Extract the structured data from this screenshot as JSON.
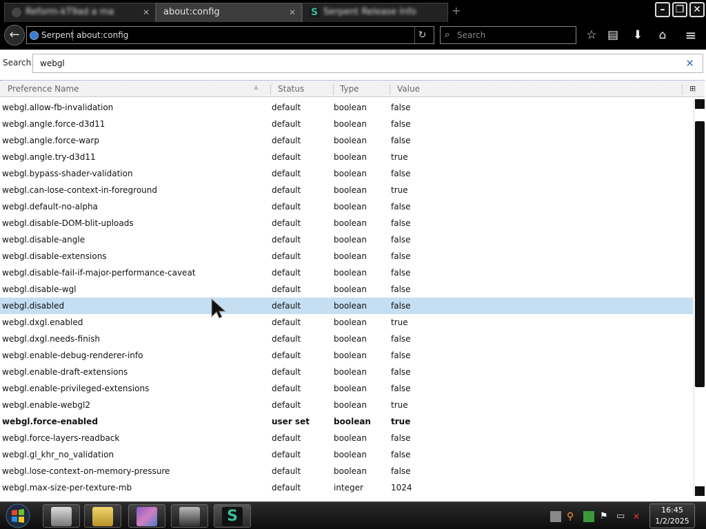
{
  "tabs": [
    {
      "title": "Reform-kT9ad a ma",
      "state": "inactive"
    },
    {
      "title": "about:config",
      "state": "active"
    },
    {
      "title": "Serpent Release Info",
      "state": "inactive"
    }
  ],
  "nav": {
    "identity_label": "Serpent",
    "url": "about:config",
    "search_placeholder": "Search"
  },
  "config": {
    "search_label": "Search:",
    "filter_value": "webgl",
    "columns": {
      "name": "Preference Name",
      "status": "Status",
      "type": "Type",
      "value": "Value"
    },
    "selected_row": 12,
    "rows": [
      {
        "name": "webgl.allow-fb-invalidation",
        "status": "default",
        "type": "boolean",
        "value": "false"
      },
      {
        "name": "webgl.angle.force-d3d11",
        "status": "default",
        "type": "boolean",
        "value": "false"
      },
      {
        "name": "webgl.angle.force-warp",
        "status": "default",
        "type": "boolean",
        "value": "false"
      },
      {
        "name": "webgl.angle.try-d3d11",
        "status": "default",
        "type": "boolean",
        "value": "true"
      },
      {
        "name": "webgl.bypass-shader-validation",
        "status": "default",
        "type": "boolean",
        "value": "false"
      },
      {
        "name": "webgl.can-lose-context-in-foreground",
        "status": "default",
        "type": "boolean",
        "value": "true"
      },
      {
        "name": "webgl.default-no-alpha",
        "status": "default",
        "type": "boolean",
        "value": "false"
      },
      {
        "name": "webgl.disable-DOM-blit-uploads",
        "status": "default",
        "type": "boolean",
        "value": "false"
      },
      {
        "name": "webgl.disable-angle",
        "status": "default",
        "type": "boolean",
        "value": "false"
      },
      {
        "name": "webgl.disable-extensions",
        "status": "default",
        "type": "boolean",
        "value": "false"
      },
      {
        "name": "webgl.disable-fail-if-major-performance-caveat",
        "status": "default",
        "type": "boolean",
        "value": "false"
      },
      {
        "name": "webgl.disable-wgl",
        "status": "default",
        "type": "boolean",
        "value": "false"
      },
      {
        "name": "webgl.disabled",
        "status": "default",
        "type": "boolean",
        "value": "false"
      },
      {
        "name": "webgl.dxgl.enabled",
        "status": "default",
        "type": "boolean",
        "value": "true"
      },
      {
        "name": "webgl.dxgl.needs-finish",
        "status": "default",
        "type": "boolean",
        "value": "false"
      },
      {
        "name": "webgl.enable-debug-renderer-info",
        "status": "default",
        "type": "boolean",
        "value": "false"
      },
      {
        "name": "webgl.enable-draft-extensions",
        "status": "default",
        "type": "boolean",
        "value": "false"
      },
      {
        "name": "webgl.enable-privileged-extensions",
        "status": "default",
        "type": "boolean",
        "value": "false"
      },
      {
        "name": "webgl.enable-webgl2",
        "status": "default",
        "type": "boolean",
        "value": "true"
      },
      {
        "name": "webgl.force-enabled",
        "status": "user set",
        "type": "boolean",
        "value": "true",
        "modified": true
      },
      {
        "name": "webgl.force-layers-readback",
        "status": "default",
        "type": "boolean",
        "value": "false"
      },
      {
        "name": "webgl.gl_khr_no_validation",
        "status": "default",
        "type": "boolean",
        "value": "false"
      },
      {
        "name": "webgl.lose-context-on-memory-pressure",
        "status": "default",
        "type": "boolean",
        "value": "false"
      },
      {
        "name": "webgl.max-size-per-texture-mb",
        "status": "default",
        "type": "integer",
        "value": "1024"
      }
    ]
  },
  "taskbar": {
    "time": "16:45",
    "date": "1/2/2025"
  },
  "colors": {
    "selected_row_bg": "#c5def2",
    "header_bg": "#f2f2f2",
    "chrome_bg": "#000000"
  }
}
